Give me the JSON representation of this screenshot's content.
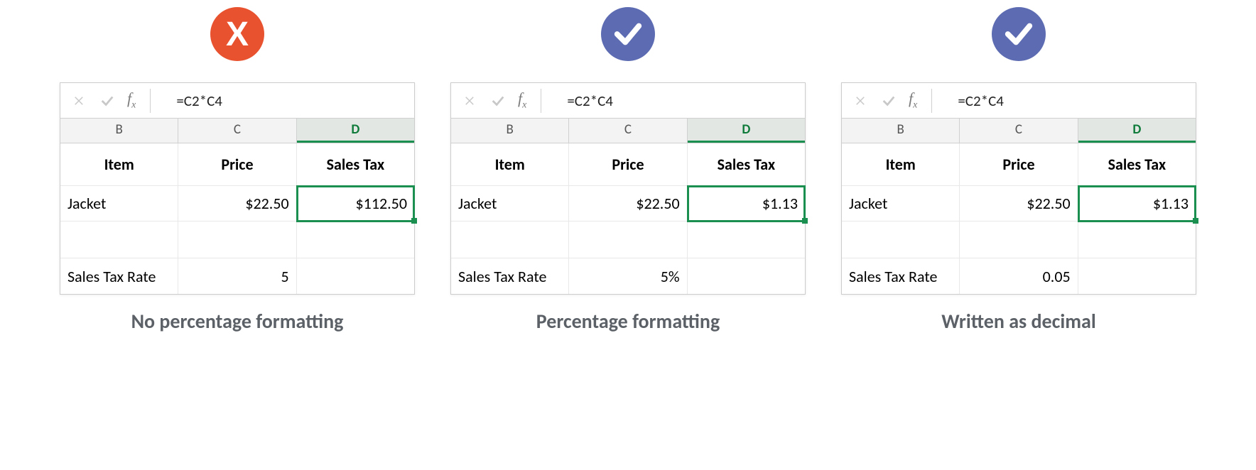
{
  "columns": [
    "B",
    "C",
    "D"
  ],
  "header_row": [
    "Item",
    "Price",
    "Sales Tax"
  ],
  "formula": "=C2*C4",
  "panels": [
    {
      "id": "no-pct",
      "badge": "x",
      "caption": "No percentage formatting",
      "data_row": [
        "Jacket",
        "$22.50",
        "$112.50"
      ],
      "rate_row": [
        "Sales Tax Rate",
        "5",
        ""
      ]
    },
    {
      "id": "pct",
      "badge": "check",
      "caption": "Percentage formatting",
      "data_row": [
        "Jacket",
        "$22.50",
        "$1.13"
      ],
      "rate_row": [
        "Sales Tax Rate",
        "5%",
        ""
      ]
    },
    {
      "id": "decimal",
      "badge": "check",
      "caption": "Written as decimal",
      "data_row": [
        "Jacket",
        "$22.50",
        "$1.13"
      ],
      "rate_row": [
        "Sales Tax Rate",
        "0.05",
        ""
      ]
    }
  ]
}
